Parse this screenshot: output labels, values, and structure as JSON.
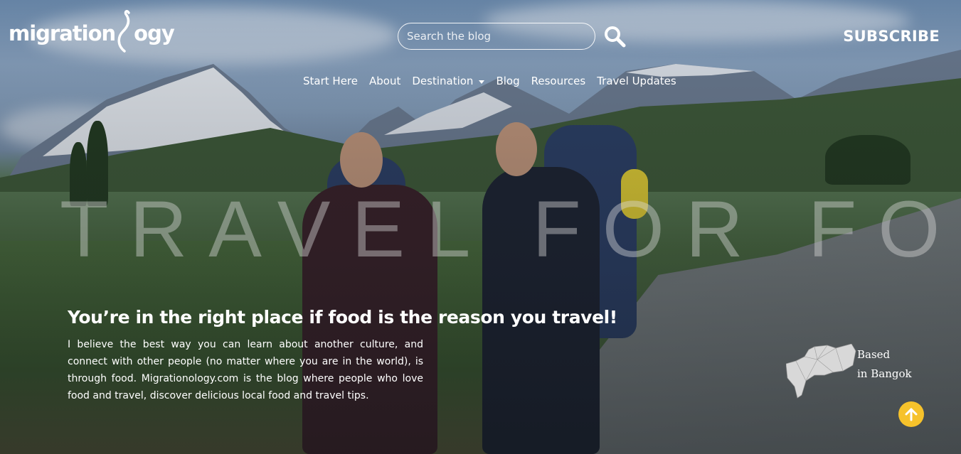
{
  "header": {
    "logo_text_left": "migration",
    "logo_text_right": "ogy",
    "search_placeholder": "Search the blog",
    "subscribe_label": "SUBSCRIBE"
  },
  "nav": {
    "items": [
      {
        "label": "Start Here"
      },
      {
        "label": "About"
      },
      {
        "label": "Destination",
        "has_dropdown": true
      },
      {
        "label": "Blog"
      },
      {
        "label": "Resources"
      },
      {
        "label": "Travel Updates"
      }
    ]
  },
  "hero": {
    "big_word": "TRAVEL FOR FOOD",
    "headline": "You’re in the right place if food is the reason you travel!",
    "intro": "I believe the best way you can learn about another culture, and connect with other people (no matter where you are in the world), is through food. Migrationology.com is the blog where people who love food and travel, discover delicious local food and travel tips.",
    "based_line1": "Based",
    "based_line2": "in Bangok"
  },
  "colors": {
    "accent_yellow": "#f6c22b",
    "text": "#ffffff"
  },
  "icons": {
    "search": "search-icon",
    "scroll_top": "arrow-up-icon",
    "map": "bangkok-map-icon"
  }
}
